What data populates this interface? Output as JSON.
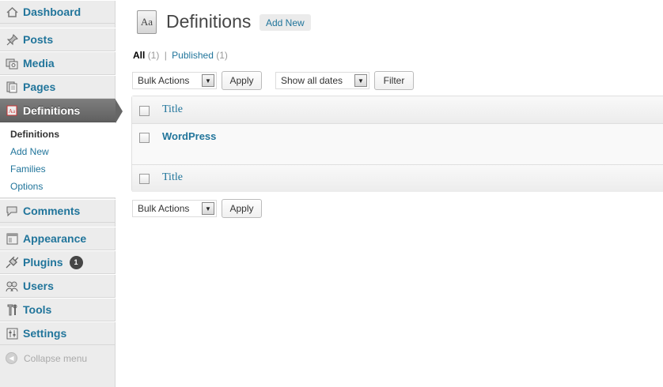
{
  "sidebar": {
    "items": [
      {
        "label": "Dashboard",
        "icon": "dashboard-icon"
      },
      {
        "label": "Posts",
        "icon": "pin-icon"
      },
      {
        "label": "Media",
        "icon": "media-icon"
      },
      {
        "label": "Pages",
        "icon": "pages-icon"
      },
      {
        "label": "Definitions",
        "icon": "definitions-icon"
      },
      {
        "label": "Comments",
        "icon": "comment-icon"
      },
      {
        "label": "Appearance",
        "icon": "appearance-icon"
      },
      {
        "label": "Plugins",
        "icon": "plug-icon",
        "badge": "1"
      },
      {
        "label": "Users",
        "icon": "users-icon"
      },
      {
        "label": "Tools",
        "icon": "tools-icon"
      },
      {
        "label": "Settings",
        "icon": "settings-icon"
      }
    ],
    "submenu": [
      "Definitions",
      "Add New",
      "Families",
      "Options"
    ],
    "collapse_label": "Collapse menu"
  },
  "header": {
    "icon_text": "Aa",
    "title": "Definitions",
    "add_new": "Add New"
  },
  "filters": {
    "all": "All",
    "all_count": "(1)",
    "separator": "|",
    "published": "Published",
    "published_count": "(1)"
  },
  "toolbar": {
    "bulk_actions": "Bulk Actions",
    "apply": "Apply",
    "dates": "Show all dates",
    "filter": "Filter"
  },
  "table": {
    "column_title": "Title",
    "rows": [
      {
        "title": "WordPress"
      }
    ]
  },
  "colors": {
    "link": "#21759b",
    "active_menu": "#6d6d6d",
    "sidebar_bg": "#ececec"
  }
}
